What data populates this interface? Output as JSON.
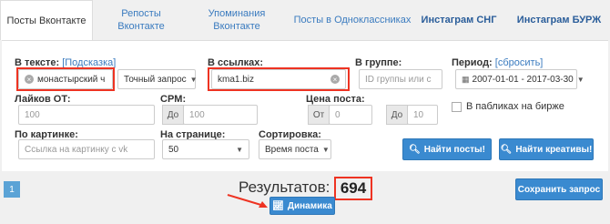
{
  "tabs": [
    {
      "label": "Посты Вконтакте"
    },
    {
      "label": "Репосты\nВконтакте"
    },
    {
      "label": "Упоминания\nВконтакте"
    },
    {
      "label": "Посты в Одноклассниках"
    },
    {
      "label": "Инстаграм СНГ"
    },
    {
      "label": "Инстаграм БУРЖ"
    }
  ],
  "filters": {
    "text_label": "В тексте:",
    "text_hint": "[Подсказка]",
    "text_value": "монастырский ч",
    "match_mode": "Точный запрос",
    "links_label": "В ссылках:",
    "links_value": "kma1.biz",
    "group_label": "В группе:",
    "group_placeholder": "ID группы или с",
    "period_label": "Период:",
    "period_reset": "[сбросить]",
    "period_value": "2007-01-01 - 2017-03-30",
    "likes_label": "Лайков ОТ:",
    "likes_placeholder": "100",
    "cpm_label": "CPM:",
    "cpm_prefix": "До",
    "cpm_placeholder": "100",
    "price_label": "Цена поста:",
    "price_from_prefix": "От",
    "price_from_placeholder": "0",
    "price_to_prefix": "До",
    "price_to_placeholder": "10",
    "exchange_label": "В пабликах на бирже",
    "image_label": "По картинке:",
    "image_placeholder": "Ссылка на картинку с vk",
    "per_page_label": "На странице:",
    "per_page_value": "50",
    "sort_label": "Сортировка:",
    "sort_value": "Время поста",
    "find_posts": "Найти посты!",
    "find_creatives": "Найти креативы!"
  },
  "results": {
    "page": "1",
    "label": "Результатов:",
    "count": "694",
    "dynamics_button": "Динамика",
    "save_button": "Сохранить запрос"
  },
  "colors": {
    "accent": "#3a8ad0",
    "highlight": "#e33322"
  }
}
